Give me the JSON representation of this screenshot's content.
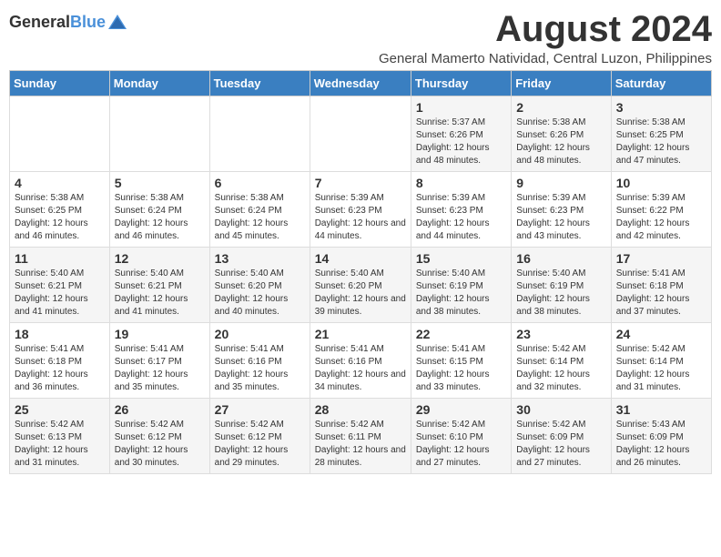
{
  "header": {
    "logo_general": "General",
    "logo_blue": "Blue",
    "title": "August 2024",
    "subtitle": "General Mamerto Natividad, Central Luzon, Philippines"
  },
  "days_of_week": [
    "Sunday",
    "Monday",
    "Tuesday",
    "Wednesday",
    "Thursday",
    "Friday",
    "Saturday"
  ],
  "weeks": [
    [
      {
        "day": "",
        "info": ""
      },
      {
        "day": "",
        "info": ""
      },
      {
        "day": "",
        "info": ""
      },
      {
        "day": "",
        "info": ""
      },
      {
        "day": "1",
        "info": "Sunrise: 5:37 AM\nSunset: 6:26 PM\nDaylight: 12 hours\nand 48 minutes."
      },
      {
        "day": "2",
        "info": "Sunrise: 5:38 AM\nSunset: 6:26 PM\nDaylight: 12 hours\nand 48 minutes."
      },
      {
        "day": "3",
        "info": "Sunrise: 5:38 AM\nSunset: 6:25 PM\nDaylight: 12 hours\nand 47 minutes."
      }
    ],
    [
      {
        "day": "4",
        "info": "Sunrise: 5:38 AM\nSunset: 6:25 PM\nDaylight: 12 hours\nand 46 minutes."
      },
      {
        "day": "5",
        "info": "Sunrise: 5:38 AM\nSunset: 6:24 PM\nDaylight: 12 hours\nand 46 minutes."
      },
      {
        "day": "6",
        "info": "Sunrise: 5:38 AM\nSunset: 6:24 PM\nDaylight: 12 hours\nand 45 minutes."
      },
      {
        "day": "7",
        "info": "Sunrise: 5:39 AM\nSunset: 6:23 PM\nDaylight: 12 hours\nand 44 minutes."
      },
      {
        "day": "8",
        "info": "Sunrise: 5:39 AM\nSunset: 6:23 PM\nDaylight: 12 hours\nand 44 minutes."
      },
      {
        "day": "9",
        "info": "Sunrise: 5:39 AM\nSunset: 6:23 PM\nDaylight: 12 hours\nand 43 minutes."
      },
      {
        "day": "10",
        "info": "Sunrise: 5:39 AM\nSunset: 6:22 PM\nDaylight: 12 hours\nand 42 minutes."
      }
    ],
    [
      {
        "day": "11",
        "info": "Sunrise: 5:40 AM\nSunset: 6:21 PM\nDaylight: 12 hours\nand 41 minutes."
      },
      {
        "day": "12",
        "info": "Sunrise: 5:40 AM\nSunset: 6:21 PM\nDaylight: 12 hours\nand 41 minutes."
      },
      {
        "day": "13",
        "info": "Sunrise: 5:40 AM\nSunset: 6:20 PM\nDaylight: 12 hours\nand 40 minutes."
      },
      {
        "day": "14",
        "info": "Sunrise: 5:40 AM\nSunset: 6:20 PM\nDaylight: 12 hours\nand 39 minutes."
      },
      {
        "day": "15",
        "info": "Sunrise: 5:40 AM\nSunset: 6:19 PM\nDaylight: 12 hours\nand 38 minutes."
      },
      {
        "day": "16",
        "info": "Sunrise: 5:40 AM\nSunset: 6:19 PM\nDaylight: 12 hours\nand 38 minutes."
      },
      {
        "day": "17",
        "info": "Sunrise: 5:41 AM\nSunset: 6:18 PM\nDaylight: 12 hours\nand 37 minutes."
      }
    ],
    [
      {
        "day": "18",
        "info": "Sunrise: 5:41 AM\nSunset: 6:18 PM\nDaylight: 12 hours\nand 36 minutes."
      },
      {
        "day": "19",
        "info": "Sunrise: 5:41 AM\nSunset: 6:17 PM\nDaylight: 12 hours\nand 35 minutes."
      },
      {
        "day": "20",
        "info": "Sunrise: 5:41 AM\nSunset: 6:16 PM\nDaylight: 12 hours\nand 35 minutes."
      },
      {
        "day": "21",
        "info": "Sunrise: 5:41 AM\nSunset: 6:16 PM\nDaylight: 12 hours\nand 34 minutes."
      },
      {
        "day": "22",
        "info": "Sunrise: 5:41 AM\nSunset: 6:15 PM\nDaylight: 12 hours\nand 33 minutes."
      },
      {
        "day": "23",
        "info": "Sunrise: 5:42 AM\nSunset: 6:14 PM\nDaylight: 12 hours\nand 32 minutes."
      },
      {
        "day": "24",
        "info": "Sunrise: 5:42 AM\nSunset: 6:14 PM\nDaylight: 12 hours\nand 31 minutes."
      }
    ],
    [
      {
        "day": "25",
        "info": "Sunrise: 5:42 AM\nSunset: 6:13 PM\nDaylight: 12 hours\nand 31 minutes."
      },
      {
        "day": "26",
        "info": "Sunrise: 5:42 AM\nSunset: 6:12 PM\nDaylight: 12 hours\nand 30 minutes."
      },
      {
        "day": "27",
        "info": "Sunrise: 5:42 AM\nSunset: 6:12 PM\nDaylight: 12 hours\nand 29 minutes."
      },
      {
        "day": "28",
        "info": "Sunrise: 5:42 AM\nSunset: 6:11 PM\nDaylight: 12 hours\nand 28 minutes."
      },
      {
        "day": "29",
        "info": "Sunrise: 5:42 AM\nSunset: 6:10 PM\nDaylight: 12 hours\nand 27 minutes."
      },
      {
        "day": "30",
        "info": "Sunrise: 5:42 AM\nSunset: 6:09 PM\nDaylight: 12 hours\nand 27 minutes."
      },
      {
        "day": "31",
        "info": "Sunrise: 5:43 AM\nSunset: 6:09 PM\nDaylight: 12 hours\nand 26 minutes."
      }
    ]
  ]
}
